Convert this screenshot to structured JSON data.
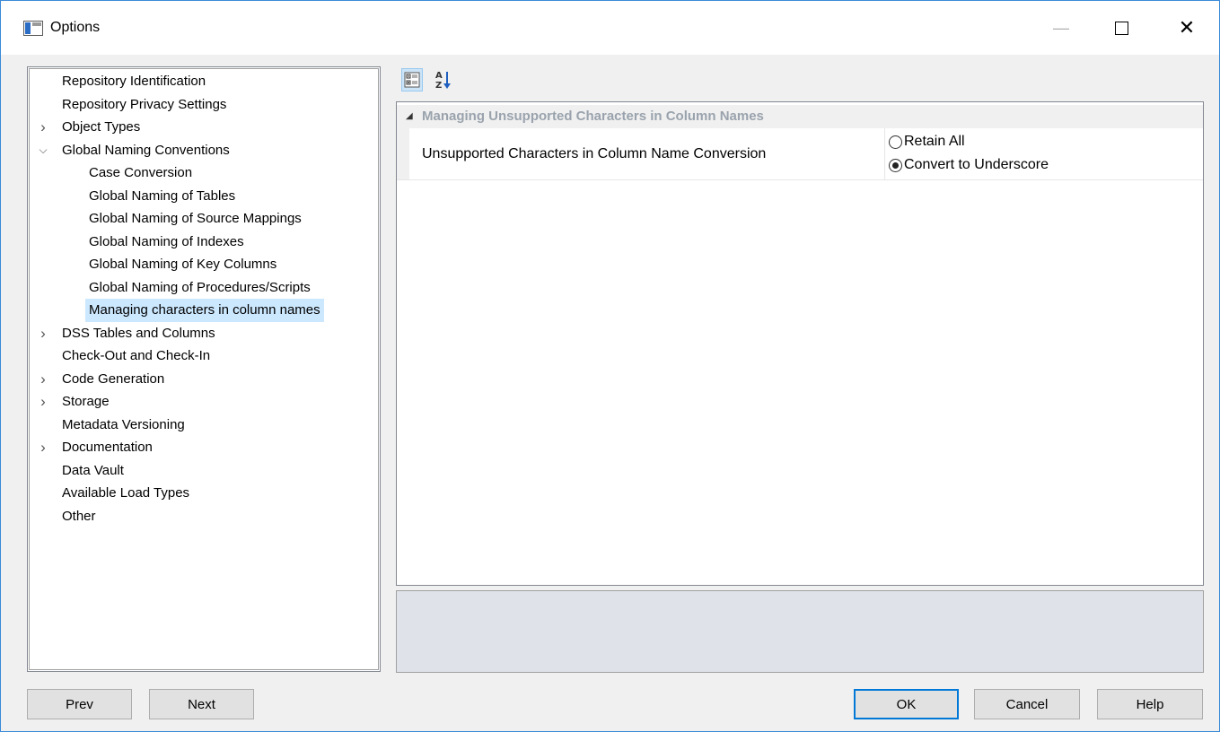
{
  "window": {
    "title": "Options",
    "icon": "window-app-icon"
  },
  "title_buttons": {
    "minimize": "—",
    "close": "✕"
  },
  "tree": {
    "items": [
      {
        "label": "Repository Identification",
        "level": 0,
        "expander": "none"
      },
      {
        "label": "Repository Privacy Settings",
        "level": 0,
        "expander": "none"
      },
      {
        "label": "Object Types",
        "level": 0,
        "expander": "collapsed"
      },
      {
        "label": "Global Naming Conventions",
        "level": 0,
        "expander": "expanded"
      },
      {
        "label": "Case Conversion",
        "level": 1,
        "expander": "none"
      },
      {
        "label": "Global Naming of Tables",
        "level": 1,
        "expander": "none"
      },
      {
        "label": "Global Naming of Source Mappings",
        "level": 1,
        "expander": "none"
      },
      {
        "label": "Global Naming of Indexes",
        "level": 1,
        "expander": "none"
      },
      {
        "label": "Global Naming of Key Columns",
        "level": 1,
        "expander": "none"
      },
      {
        "label": "Global Naming of Procedures/Scripts",
        "level": 1,
        "expander": "none"
      },
      {
        "label": "Managing characters in column names",
        "level": 1,
        "expander": "none",
        "selected": true
      },
      {
        "label": "DSS Tables and Columns",
        "level": 0,
        "expander": "collapsed"
      },
      {
        "label": "Check-Out and Check-In",
        "level": 0,
        "expander": "none"
      },
      {
        "label": "Code Generation",
        "level": 0,
        "expander": "collapsed"
      },
      {
        "label": "Storage",
        "level": 0,
        "expander": "collapsed"
      },
      {
        "label": "Metadata Versioning",
        "level": 0,
        "expander": "none"
      },
      {
        "label": "Documentation",
        "level": 0,
        "expander": "collapsed"
      },
      {
        "label": "Data Vault",
        "level": 0,
        "expander": "none"
      },
      {
        "label": "Available Load Types",
        "level": 0,
        "expander": "none"
      },
      {
        "label": "Other",
        "level": 0,
        "expander": "none"
      }
    ]
  },
  "toolbar": {
    "categorized_icon": "categorized-view-icon",
    "alphabetical_icon": "sort-alphabetical-icon",
    "categorized_active": true
  },
  "property_grid": {
    "category": "Managing Unsupported Characters in Column Names",
    "property_name": "Unsupported Characters in Column Name Conversion",
    "options": [
      {
        "label": "Retain All",
        "checked": false
      },
      {
        "label": "Convert to Underscore",
        "checked": true
      }
    ]
  },
  "buttons": {
    "prev": "Prev",
    "next": "Next",
    "ok": "OK",
    "cancel": "Cancel",
    "help": "Help"
  },
  "colors": {
    "selection": "#cce8ff",
    "category_text": "#9aa3ad",
    "default_button_border": "#0078d7",
    "description_pane": "#dfe2e8"
  }
}
